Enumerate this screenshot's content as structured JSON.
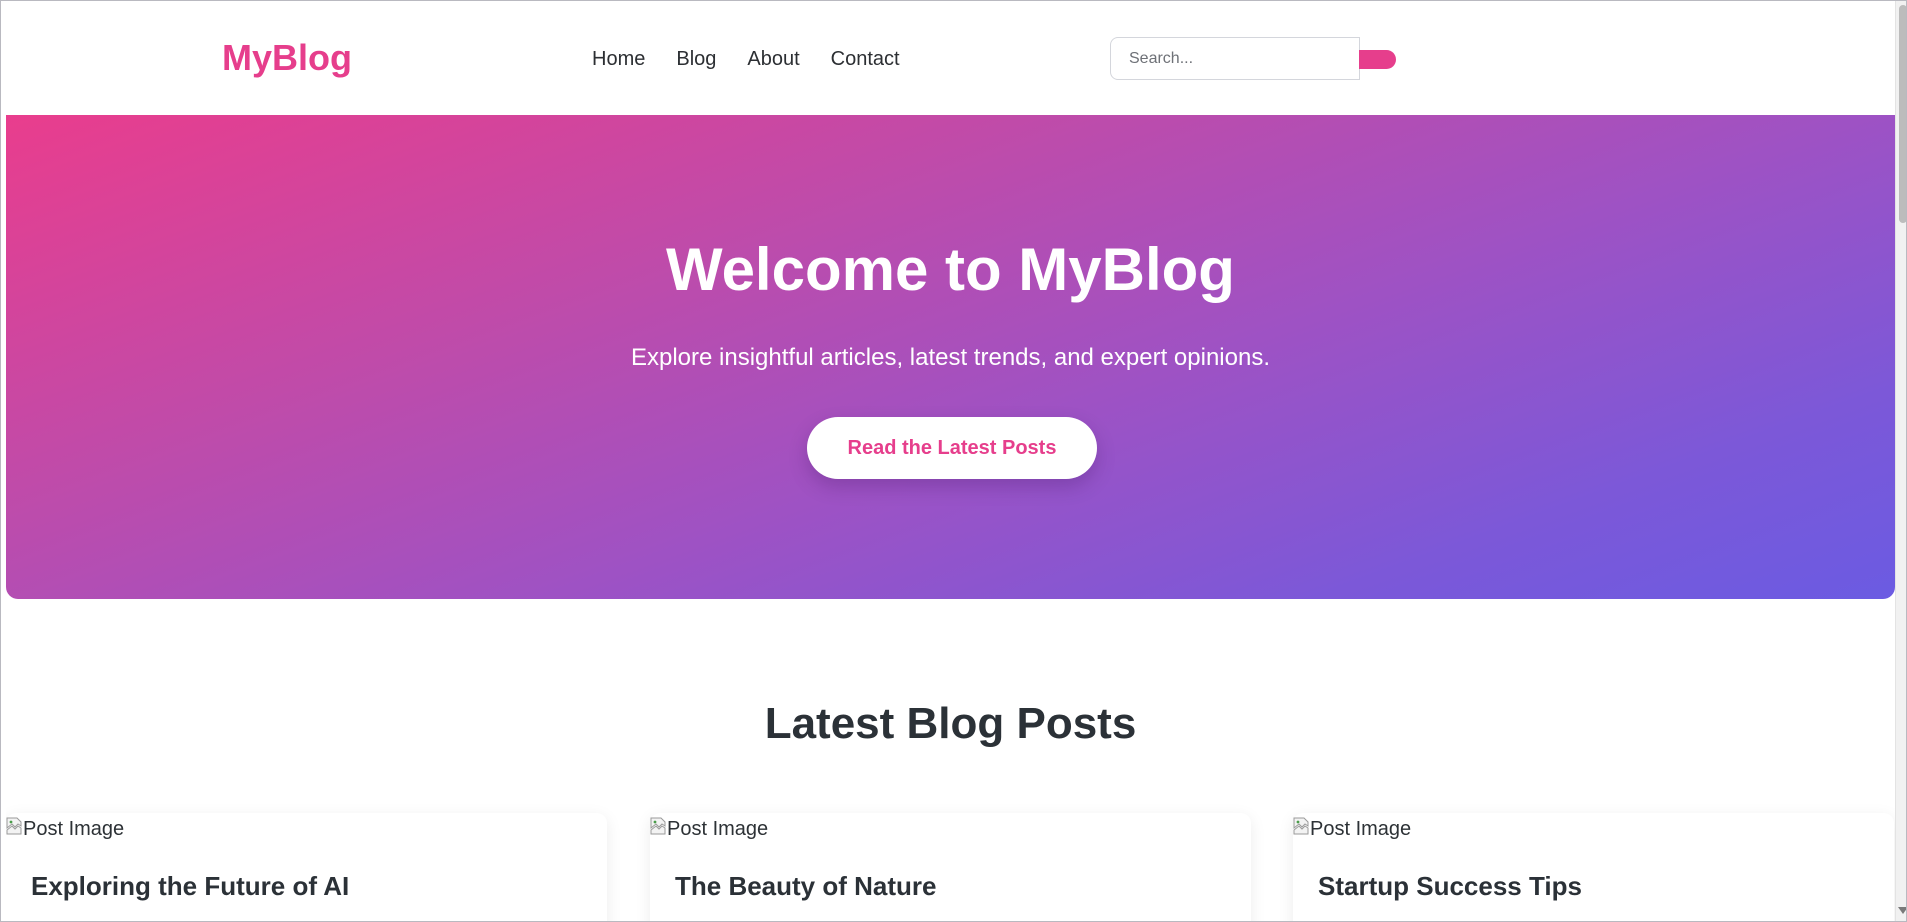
{
  "header": {
    "logo": "MyBlog",
    "nav": [
      "Home",
      "Blog",
      "About",
      "Contact"
    ],
    "search": {
      "placeholder": "Search..."
    }
  },
  "hero": {
    "title": "Welcome to MyBlog",
    "subtitle": "Explore insightful articles, latest trends, and expert opinions.",
    "cta_label": "Read the Latest Posts"
  },
  "posts": {
    "section_title": "Latest Blog Posts",
    "items": [
      {
        "image_alt": "Post Image",
        "title": "Exploring the Future of AI"
      },
      {
        "image_alt": "Post Image",
        "title": "The Beauty of Nature"
      },
      {
        "image_alt": "Post Image",
        "title": "Startup Success Tips"
      }
    ]
  },
  "colors": {
    "brand_pink": "#e63e8c",
    "hero_gradient_start": "#e93d8d",
    "hero_gradient_end": "#6b5be2",
    "text_dark": "#2b3137"
  },
  "icons": [
    "broken-image-icon",
    "scroll-down-arrow-icon"
  ]
}
